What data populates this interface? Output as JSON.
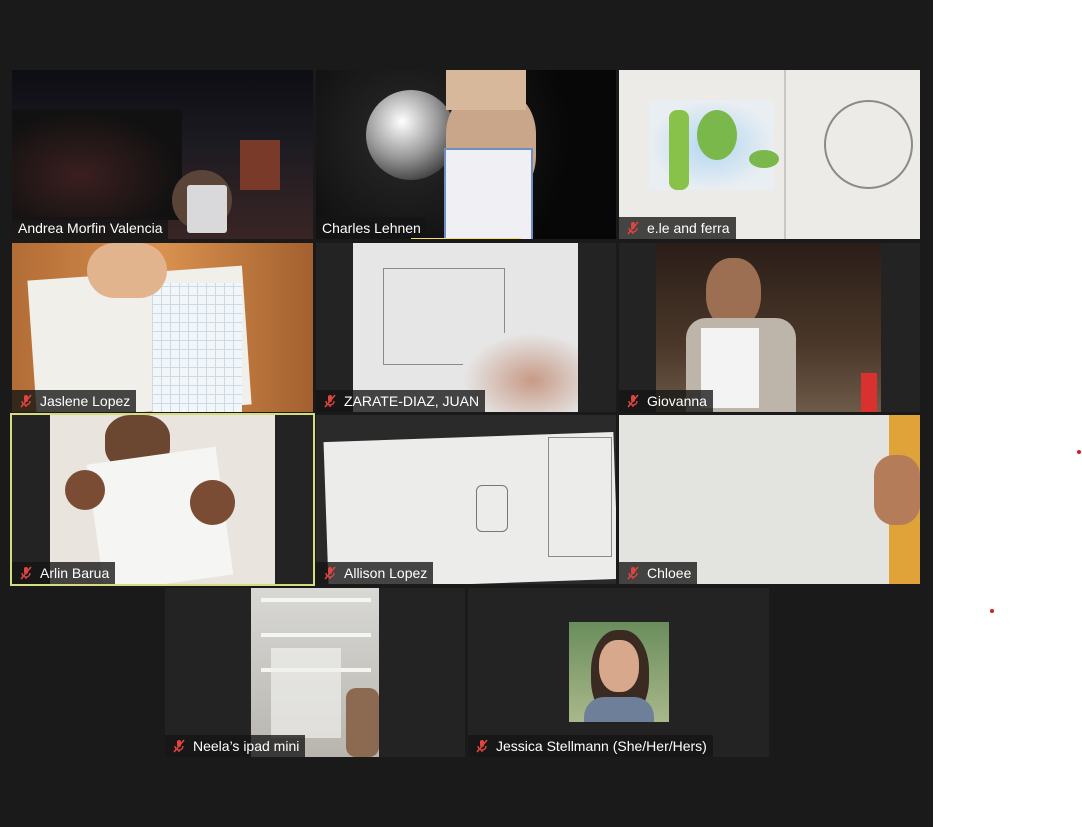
{
  "participants": [
    {
      "name": "Andrea Morfin Valencia",
      "muted": false
    },
    {
      "name": "Charles Lehnen",
      "muted": false,
      "speaking": true
    },
    {
      "name": "e.le and ferra",
      "muted": true
    },
    {
      "name": "Jaslene Lopez",
      "muted": true
    },
    {
      "name": "ZARATE-DIAZ, JUAN",
      "muted": true
    },
    {
      "name": "Giovanna",
      "muted": true
    },
    {
      "name": "Arlin Barua",
      "muted": true,
      "active": true
    },
    {
      "name": "Allison Lopez",
      "muted": true
    },
    {
      "name": "Chloee",
      "muted": true
    },
    {
      "name": "Neela’s ipad mini",
      "muted": true
    },
    {
      "name": "Jessica Stellmann (She/Her/Hers)",
      "muted": true
    }
  ],
  "colors": {
    "background": "#1a1a1a",
    "tile": "#232323",
    "active_border": "#d6dd80",
    "muted_icon": "#e0443e",
    "speaking_bar": "#f5e06a"
  },
  "icons": {
    "muted": "mic-muted-icon"
  }
}
